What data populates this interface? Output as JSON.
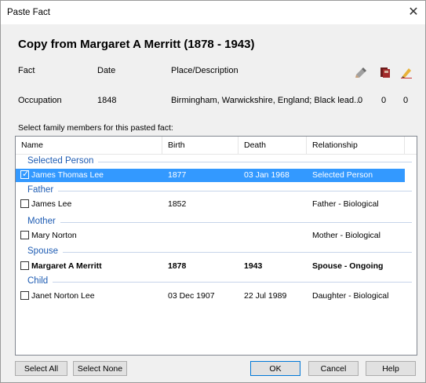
{
  "window": {
    "title": "Paste Fact",
    "close_label": "✕"
  },
  "header": {
    "title": "Copy from Margaret A Merritt (1878 - 1943)"
  },
  "fact_table": {
    "headers": {
      "fact": "Fact",
      "date": "Date",
      "place": "Place/Description"
    },
    "row": {
      "fact": "Occupation",
      "date": "1848",
      "place": "Birmingham, Warwickshire, England; Black lead...",
      "count1": "0",
      "count2": "0",
      "count3": "0"
    },
    "icons": [
      "source-icon",
      "media-icon",
      "note-icon"
    ]
  },
  "select_label": "Select family members for this pasted fact:",
  "columns": {
    "name": "Name",
    "birth": "Birth",
    "death": "Death",
    "relationship": "Relationship"
  },
  "groups": [
    {
      "label": "Selected Person"
    },
    {
      "label": "Father"
    },
    {
      "label": "Mother"
    },
    {
      "label": "Spouse"
    },
    {
      "label": "Child"
    }
  ],
  "people": [
    {
      "name": "James Thomas Lee",
      "birth": "1877",
      "death": "03 Jan 1968",
      "relationship": "Selected Person",
      "checked": true
    },
    {
      "name": "James Lee",
      "birth": "1852",
      "death": "",
      "relationship": "Father - Biological",
      "checked": false
    },
    {
      "name": "Mary Norton",
      "birth": "",
      "death": "",
      "relationship": "Mother - Biological",
      "checked": false
    },
    {
      "name": "Margaret A Merritt",
      "birth": "1878",
      "death": "1943",
      "relationship": "Spouse - Ongoing",
      "checked": false
    },
    {
      "name": "Janet Norton Lee",
      "birth": "03 Dec 1907",
      "death": "22 Jul 1989",
      "relationship": "Daughter - Biological",
      "checked": false
    }
  ],
  "buttons": {
    "select_all": "Select All",
    "select_none": "Select None",
    "ok": "OK",
    "cancel": "Cancel",
    "help": "Help"
  },
  "colors": {
    "accent": "#3399ff",
    "group_header": "#1e5cb3"
  }
}
